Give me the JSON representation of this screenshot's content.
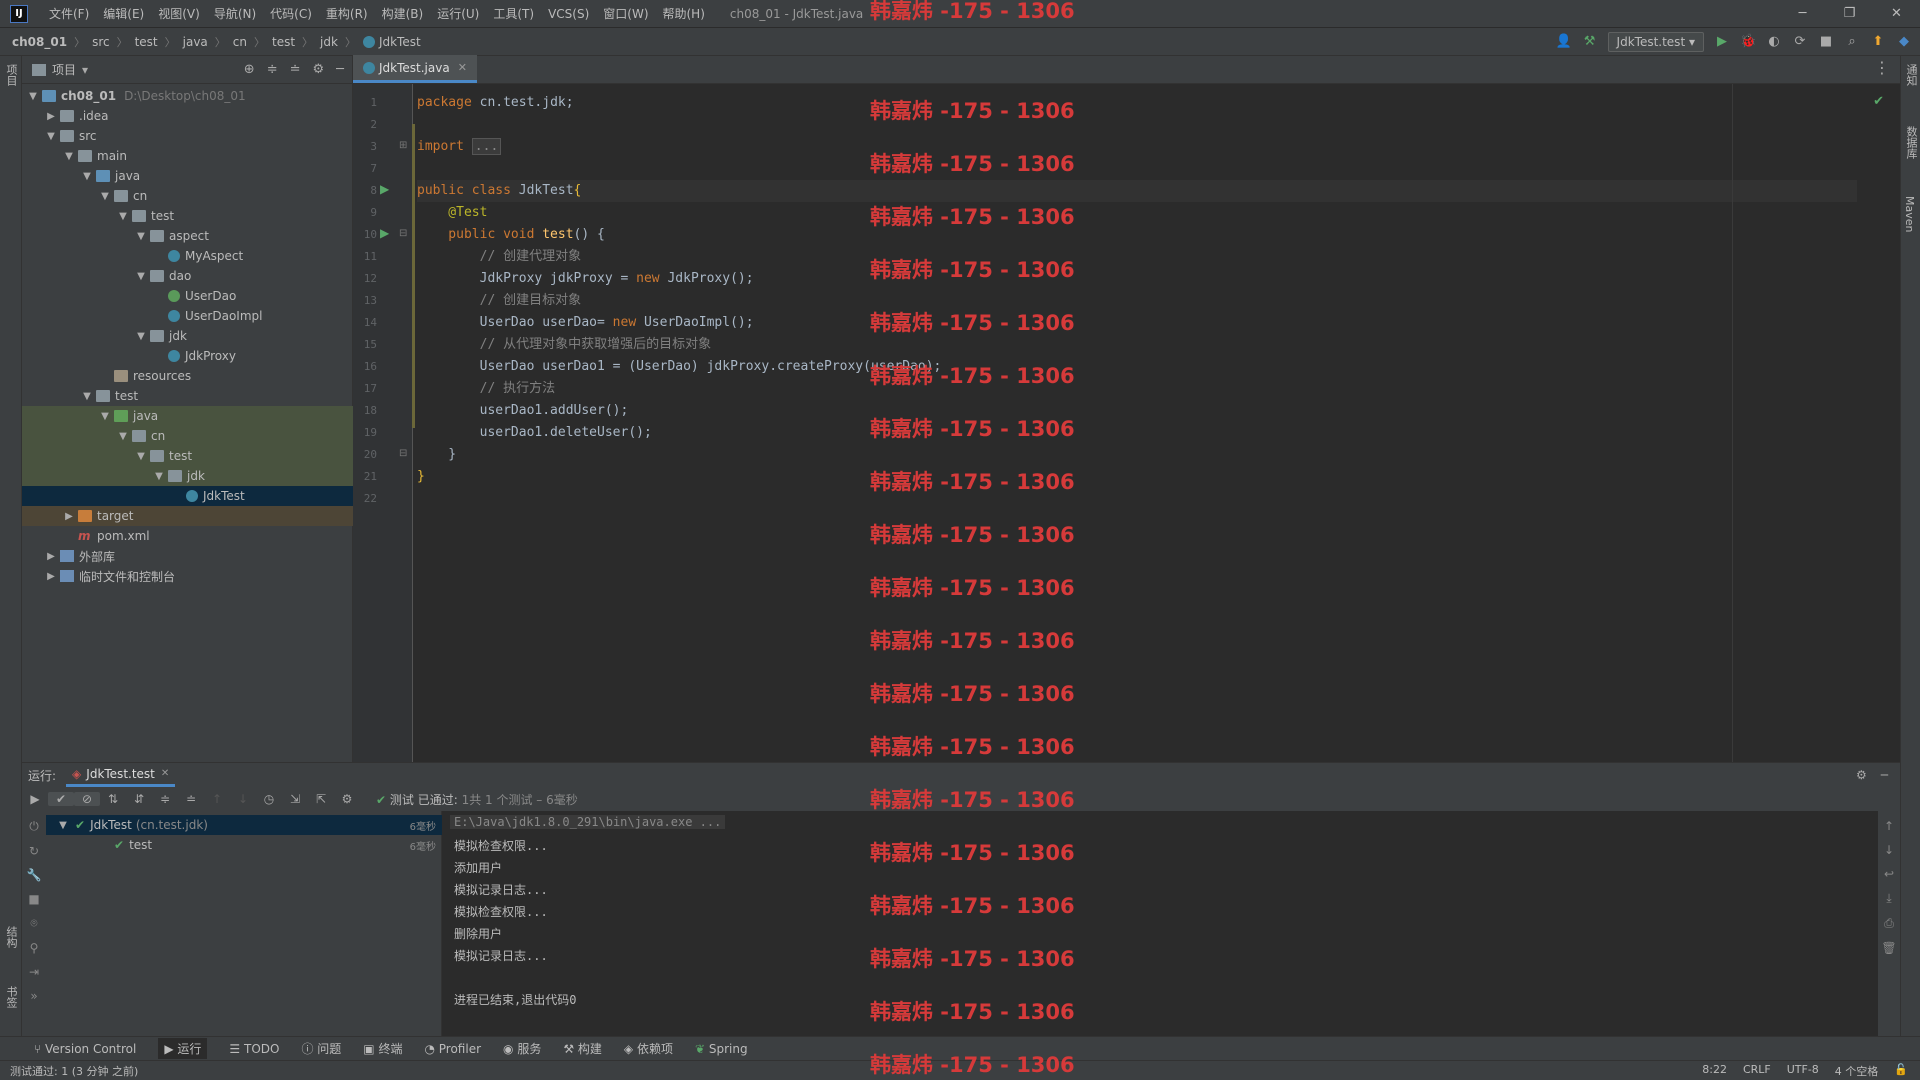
{
  "menubar": {
    "items": [
      "文件(F)",
      "编辑(E)",
      "视图(V)",
      "导航(N)",
      "代码(C)",
      "重构(R)",
      "构建(B)",
      "运行(U)",
      "工具(T)",
      "VCS(S)",
      "窗口(W)",
      "帮助(H)"
    ],
    "window_title": "ch08_01 - JdkTest.java"
  },
  "breadcrumb": [
    "ch08_01",
    "src",
    "test",
    "java",
    "cn",
    "test",
    "jdk",
    "JdkTest"
  ],
  "toolbar": {
    "run_config": "JdkTest.test"
  },
  "left_strip": {
    "project": "项目",
    "structure": "结构",
    "bookmarks": "书签"
  },
  "right_strip": {
    "notifications": "通知",
    "database": "数据库",
    "maven": "Maven"
  },
  "project_panel": {
    "title": "项目",
    "tree": [
      {
        "label": "ch08_01",
        "path": "D:\\Desktop\\ch08_01"
      },
      {
        "label": ".idea"
      },
      {
        "label": "src"
      },
      {
        "label": "main"
      },
      {
        "label": "java"
      },
      {
        "label": "cn"
      },
      {
        "label": "test"
      },
      {
        "label": "aspect"
      },
      {
        "label": "MyAspect"
      },
      {
        "label": "dao"
      },
      {
        "label": "UserDao"
      },
      {
        "label": "UserDaoImpl"
      },
      {
        "label": "jdk"
      },
      {
        "label": "JdkProxy"
      },
      {
        "label": "resources"
      },
      {
        "label": "test"
      },
      {
        "label": "java"
      },
      {
        "label": "cn"
      },
      {
        "label": "test"
      },
      {
        "label": "jdk"
      },
      {
        "label": "JdkTest"
      },
      {
        "label": "target"
      },
      {
        "label": "pom.xml"
      },
      {
        "label": "外部库"
      },
      {
        "label": "临时文件和控制台"
      }
    ]
  },
  "editor": {
    "tab": "JdkTest.java",
    "line_numbers": [
      "1",
      "2",
      "3",
      "7",
      "8",
      "9",
      "10",
      "11",
      "12",
      "13",
      "14",
      "15",
      "16",
      "17",
      "18",
      "19",
      "20",
      "21",
      "22"
    ],
    "code": {
      "l1_kw": "package",
      "l1_rest": " cn.test.jdk;",
      "l3_kw": "import",
      "l3_fold": "...",
      "l8_kw": "public class",
      "l8_name": " JdkTest",
      "l8_brace": "{",
      "l9_ann": "    @Test",
      "l10_kw": "    public void",
      "l10_fn": " test",
      "l10_rest": "() {",
      "l11": "        // 创建代理对象",
      "l12_a": "        JdkProxy jdkProxy = ",
      "l12_kw": "new",
      "l12_b": " JdkProxy();",
      "l13": "        // 创建目标对象",
      "l14_a": "        UserDao userDao= ",
      "l14_kw": "new",
      "l14_b": " UserDaoImpl();",
      "l15": "        // 从代理对象中获取增强后的目标对象",
      "l16": "        UserDao userDao1 = (UserDao) jdkProxy.createProxy(userDao);",
      "l17": "        // 执行方法",
      "l18": "        userDao1.addUser();",
      "l19": "        userDao1.deleteUser();",
      "l20": "    }",
      "l21": "}"
    }
  },
  "run_panel": {
    "label": "运行:",
    "tab": "JdkTest.test",
    "pass_prefix": "测试 已通过:",
    "pass_count": "1共 1 个测试 – 6毫秒",
    "tests": [
      {
        "name": "JdkTest",
        "pkg": "(cn.test.jdk)",
        "time": "6毫秒"
      },
      {
        "name": "test",
        "time": "6毫秒"
      }
    ],
    "console": [
      "E:\\Java\\jdk1.8.0_291\\bin\\java.exe ...",
      "模拟检查权限...",
      "添加用户",
      "模拟记录日志...",
      "模拟检查权限...",
      "删除用户",
      "模拟记录日志...",
      "",
      "进程已结束,退出代码0"
    ]
  },
  "bottom_tabs": [
    "Version Control",
    "运行",
    "TODO",
    "问题",
    "终端",
    "Profiler",
    "服务",
    "构建",
    "依赖项",
    "Spring"
  ],
  "status": {
    "message": "测试通过: 1 (3 分钟 之前)",
    "position": "8:22",
    "line_sep": "CRLF",
    "encoding": "UTF-8",
    "indent": "4 个空格"
  },
  "watermark": "韩嘉炜 -175 - 1306",
  "colors": {
    "accent": "#4a88c7",
    "pass": "#59a869",
    "watermark": "#d63a3a"
  }
}
